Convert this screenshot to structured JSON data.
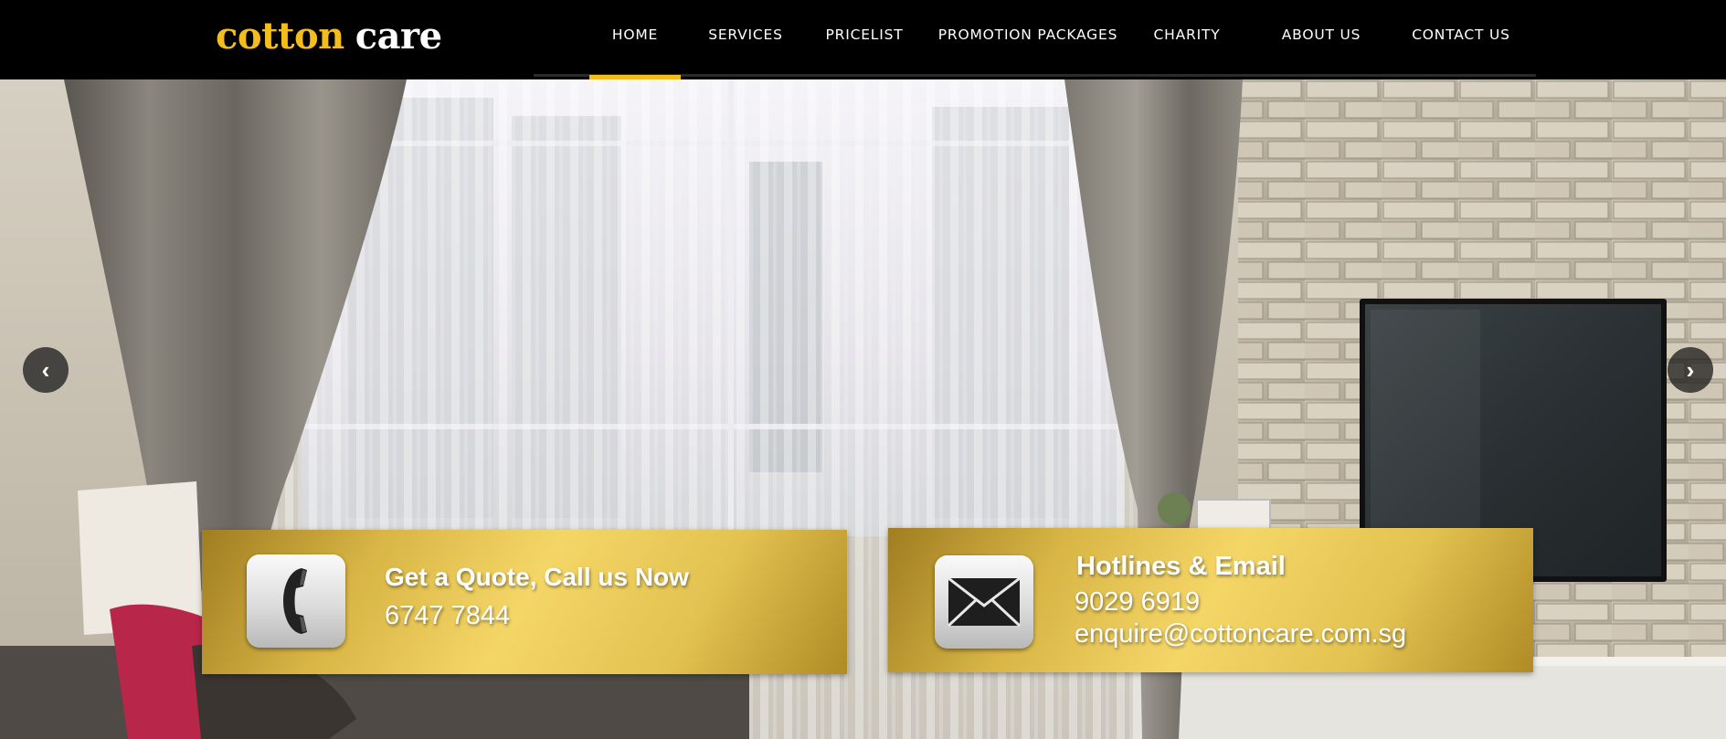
{
  "brand": {
    "logo_word_1": "cotton",
    "logo_word_2": "care",
    "accent_color": "#f2bd1d"
  },
  "nav": {
    "items": [
      {
        "label": "HOME",
        "active": true
      },
      {
        "label": "SERVICES",
        "active": false
      },
      {
        "label": "PRICELIST",
        "active": false
      },
      {
        "label": "PROMOTION PACKAGES",
        "active": false
      },
      {
        "label": "CHARITY",
        "active": false
      },
      {
        "label": "ABOUT US",
        "active": false
      },
      {
        "label": "CONTACT US",
        "active": false
      }
    ]
  },
  "carousel": {
    "prev_icon": "chevron-left-icon",
    "next_icon": "chevron-right-icon",
    "prev_glyph": "‹",
    "next_glyph": "›"
  },
  "quote_card": {
    "title": "Get a Quote, Call us Now",
    "phone": "6747 7844",
    "icon": "phone-icon"
  },
  "hotline_card": {
    "title": "Hotlines & Email",
    "phone": "9029 6919",
    "email": "enquire@cottoncare.com.sg",
    "icon": "envelope-icon"
  }
}
